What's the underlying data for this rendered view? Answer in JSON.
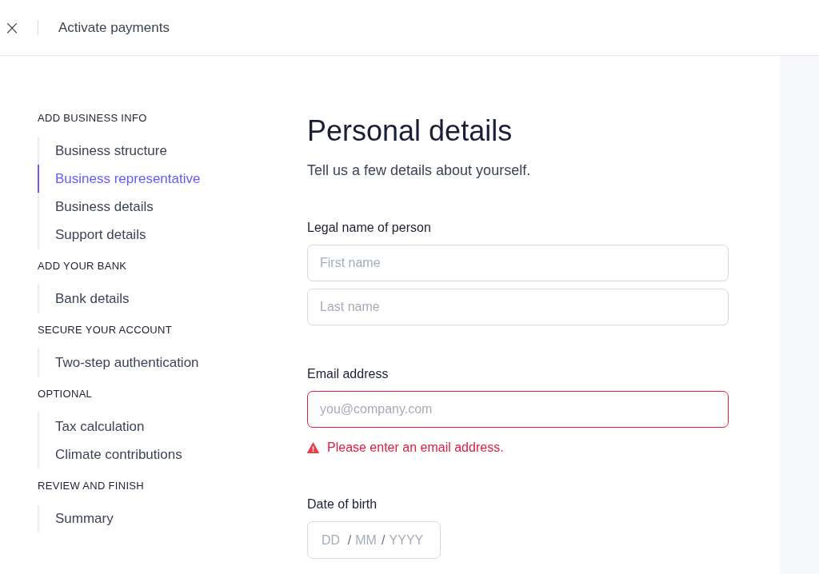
{
  "header": {
    "close_icon": "×",
    "title": "Activate payments"
  },
  "sidebar": {
    "groups": [
      {
        "heading": "ADD BUSINESS INFO",
        "items": [
          {
            "label": "Business structure",
            "selected": false
          },
          {
            "label": "Business representative",
            "selected": true
          },
          {
            "label": "Business details",
            "selected": false
          },
          {
            "label": "Support details",
            "selected": false
          }
        ]
      },
      {
        "heading": "ADD YOUR BANK",
        "items": [
          {
            "label": "Bank details",
            "selected": false
          }
        ]
      },
      {
        "heading": "SECURE YOUR ACCOUNT",
        "items": [
          {
            "label": "Two-step authentication",
            "selected": false
          }
        ]
      },
      {
        "heading": "OPTIONAL",
        "items": [
          {
            "label": "Tax calculation",
            "selected": false
          },
          {
            "label": "Climate contributions",
            "selected": false
          }
        ]
      },
      {
        "heading": "REVIEW AND FINISH",
        "items": [
          {
            "label": "Summary",
            "selected": false
          }
        ]
      }
    ]
  },
  "form": {
    "title": "Personal details",
    "subtitle": "Tell us a few details about yourself.",
    "fields": [
      {
        "kind": "text",
        "label": "Legal name of person",
        "inputs": [
          {
            "placeholder": "First name",
            "invalid": false
          },
          {
            "placeholder": "Last name",
            "invalid": false
          }
        ]
      },
      {
        "kind": "text",
        "label": "Email address",
        "inputs": [
          {
            "placeholder": "you@company.com",
            "invalid": true
          }
        ],
        "error": "Please enter an email address."
      },
      {
        "kind": "date",
        "label": "Date of birth",
        "segments": [
          {
            "placeholder": "DD",
            "separator": "/"
          },
          {
            "placeholder": "MM",
            "separator": "/"
          },
          {
            "placeholder": "YYYY"
          }
        ]
      }
    ]
  }
}
